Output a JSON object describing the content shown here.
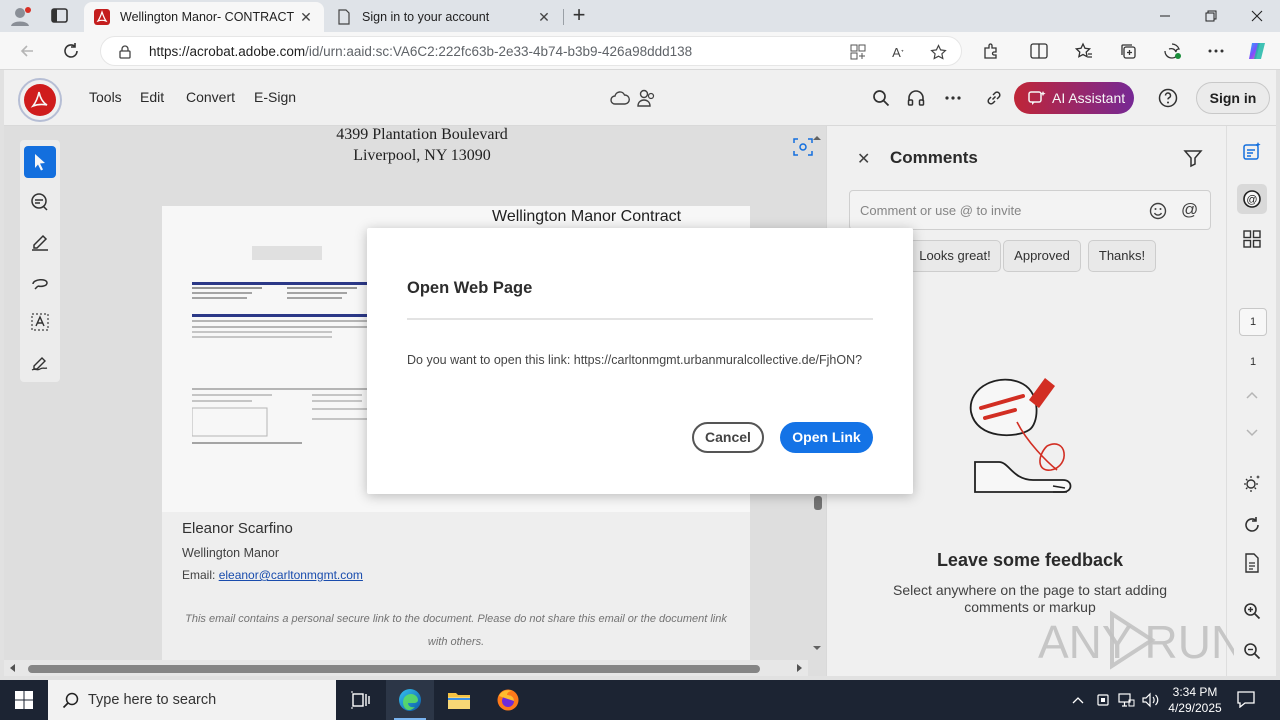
{
  "browser": {
    "tabs": [
      {
        "title": "Wellington Manor- CONTRACT F",
        "active": true
      },
      {
        "title": "Sign in to your account",
        "active": false
      }
    ],
    "address": {
      "host": "https://acrobat.adobe.com",
      "path": "/id/urn:aaid:sc:VA6C2:222fc63b-2e33-4b74-b3b9-426a98ddd138"
    }
  },
  "acrobat": {
    "menu": [
      "Tools",
      "Edit",
      "Convert",
      "E-Sign"
    ],
    "ai_assistant_label": "AI Assistant",
    "sign_in_label": "Sign in"
  },
  "document": {
    "address_line1": "4399 Plantation Boulevard",
    "address_line2": "Liverpool, NY 13090",
    "contract_title": "Wellington Manor Contract",
    "signature": {
      "name": "Eleanor Scarfino",
      "company": "Wellington Manor",
      "email_label": "Email:",
      "email": "eleanor@carltonmgmt.com"
    },
    "disclaimer": "This email contains a personal secure link to the document. Please do not share this email or the document link with others."
  },
  "comments": {
    "title": "Comments",
    "placeholder": "Comment or use @ to invite",
    "chips": [
      "Looks great!",
      "Approved",
      "Thanks!"
    ],
    "empty_title": "Leave some feedback",
    "empty_subtitle": "Select anywhere on the page to start adding comments or markup"
  },
  "pager": {
    "current": "1",
    "total": "1"
  },
  "dialog": {
    "title": "Open Web Page",
    "message": "Do you want to open this link: https://carltonmgmt.urbanmuralcollective.de/FjhON?",
    "cancel_label": "Cancel",
    "open_label": "Open Link"
  },
  "watermark": "ANY RUN",
  "taskbar": {
    "search_placeholder": "Type here to search",
    "time": "3:34 PM",
    "date": "4/29/2025"
  },
  "colors": {
    "accent_blue": "#1473e6",
    "acrobat_red": "#d61d1d",
    "taskbar_bg": "#1c2433"
  }
}
